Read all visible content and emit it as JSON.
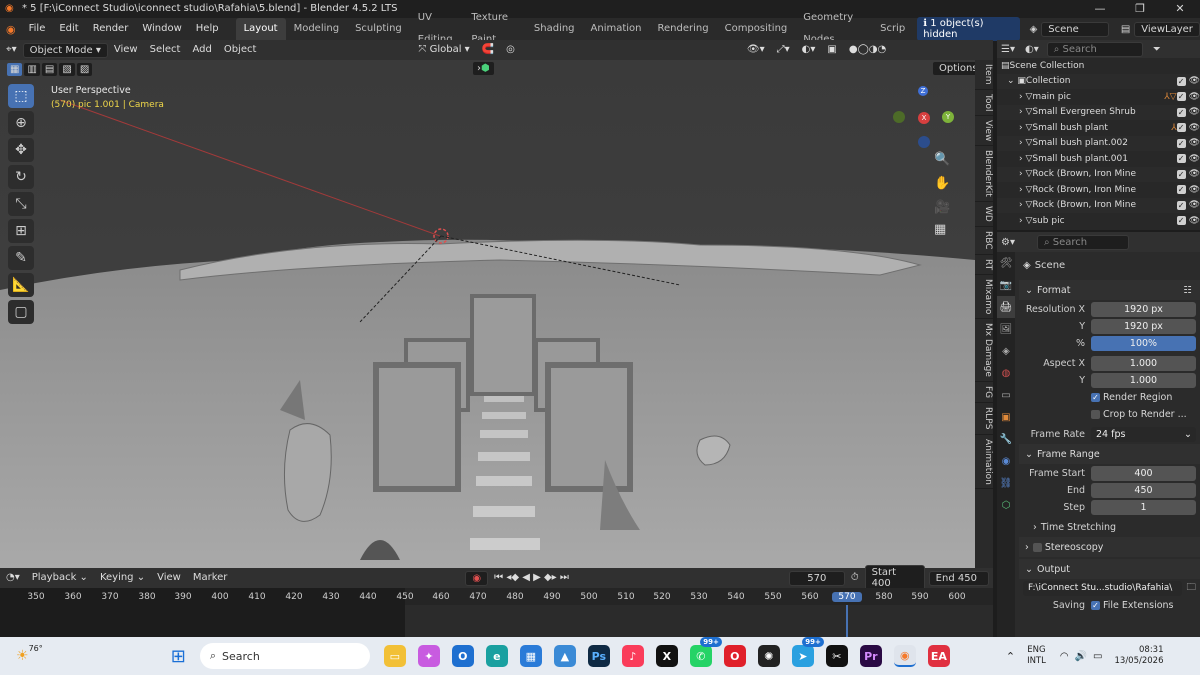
{
  "window": {
    "title": "* 5 [F:\\iConnect Studio\\iconnect studio\\Rafahia\\5.blend] - Blender 4.5.2 LTS"
  },
  "menus": [
    "File",
    "Edit",
    "Render",
    "Window",
    "Help"
  ],
  "workspaces": [
    "Layout",
    "Modeling",
    "Sculpting",
    "UV Editing",
    "Texture Paint",
    "Shading",
    "Animation",
    "Rendering",
    "Compositing",
    "Geometry Nodes",
    "Scrip"
  ],
  "notice": "1 object(s) hidden",
  "scene_name": "Scene",
  "view_layer": "ViewLayer",
  "viewport": {
    "mode": "Object Mode",
    "menus": [
      "View",
      "Select",
      "Add",
      "Object"
    ],
    "transform": "Global",
    "options": "Options",
    "overlay_title": "User Perspective",
    "overlay_sub": "(570) pic 1.001 | Camera",
    "axes": {
      "z": "Z",
      "x": "X",
      "y": "Y"
    }
  },
  "n_tabs": [
    "Item",
    "Tool",
    "View",
    "BlenderKit",
    "WD",
    "RBC",
    "RT",
    "Mixamo",
    "Mx Damage",
    "FG",
    "RLPS",
    "Animation"
  ],
  "outliner": {
    "search": "Search",
    "root": "Scene Collection",
    "collection": "Collection",
    "items": [
      "main pic",
      "Small Evergreen Shrub",
      "Small bush plant",
      "Small bush plant.002",
      "Small bush plant.001",
      "Rock (Brown, Iron Mine",
      "Rock (Brown, Iron Mine",
      "Rock (Brown, Iron Mine",
      "sub pic"
    ]
  },
  "properties": {
    "search": "Search",
    "context": "Scene",
    "format": {
      "title": "Format",
      "res_x_label": "Resolution X",
      "res_x": "1920 px",
      "res_y_label": "Y",
      "res_y": "1920 px",
      "pct_label": "%",
      "pct": "100%",
      "aspect_x_label": "Aspect X",
      "aspect_x": "1.000",
      "aspect_y_label": "Y",
      "aspect_y": "1.000",
      "render_region": "Render Region",
      "crop": "Crop to Render ...",
      "fps_label": "Frame Rate",
      "fps": "24 fps"
    },
    "frame_range": {
      "title": "Frame Range",
      "start_label": "Frame Start",
      "start": "400",
      "end_label": "End",
      "end": "450",
      "step_label": "Step",
      "step": "1"
    },
    "time_stretching": "Time Stretching",
    "stereoscopy": "Stereoscopy",
    "output": {
      "title": "Output",
      "path": "F:\\iConnect Stu...studio\\Rafahia\\",
      "saving": "Saving",
      "file_ext": "File Extensions"
    }
  },
  "timeline": {
    "menus": [
      "Playback",
      "Keying",
      "View",
      "Marker"
    ],
    "current": "570",
    "start_label": "Start",
    "start": "400",
    "end_label": "End",
    "end": "450",
    "ticks": [
      "350",
      "360",
      "370",
      "380",
      "390",
      "400",
      "410",
      "420",
      "430",
      "440",
      "450",
      "460",
      "470",
      "480",
      "490",
      "500",
      "510",
      "520",
      "530",
      "540",
      "550",
      "560",
      "570",
      "580",
      "590",
      "600"
    ]
  },
  "taskbar": {
    "weather": "76°",
    "search": "Search",
    "lang1": "ENG",
    "lang2": "INTL",
    "time": "08:31",
    "date": "13/05/2026",
    "badge1": "99+",
    "badge2": "99+"
  }
}
